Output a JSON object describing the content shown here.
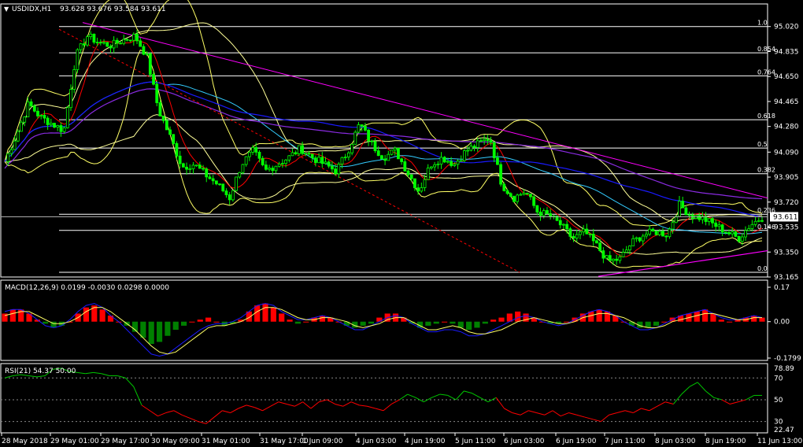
{
  "window": {
    "symbol_header": "USDIDX,H1",
    "ohlc": "93.628 93.676 93.584 93.611"
  },
  "colors": {
    "background": "#000000",
    "axis": "#ffffff",
    "candle": "#00ff00",
    "fib": "#ffffff",
    "bb_outer": "#ffff66",
    "bb_inner": "#ffff99",
    "ma_red": "#ff0000",
    "ma_cyan": "#33ccff",
    "ma_blue": "#1a1aff",
    "ma_purple": "#8a2be2",
    "trend_magenta": "#ff00ff",
    "trend_red_dash": "#ff0000",
    "macd_pos": "#ff0000",
    "macd_neg": "#008000",
    "macd_signal": "#ffff66",
    "macd_line": "#1a1aff",
    "rsi_above": "#00c800",
    "rsi_below": "#ff0000"
  },
  "chart_data": [
    {
      "type": "line",
      "name": "USDIDX,H1",
      "ylim": [
        93.165,
        95.1
      ],
      "y_ticks": [
        "95.020",
        "94.835",
        "94.650",
        "94.465",
        "94.280",
        "94.090",
        "93.905",
        "93.720",
        "93.535",
        "93.350",
        "93.165"
      ],
      "current_price": "93.611",
      "fib_levels": [
        {
          "label": "1.0",
          "value": 95.02
        },
        {
          "label": "0.854",
          "value": 94.825
        },
        {
          "label": "0.764",
          "value": 94.655
        },
        {
          "label": "0.618",
          "value": 94.33
        },
        {
          "label": "0.5",
          "value": 94.12
        },
        {
          "label": "0.382",
          "value": 93.93
        },
        {
          "label": "0.236",
          "value": 93.63
        },
        {
          "label": "0.146",
          "value": 93.51
        },
        {
          "label": "0.0",
          "value": 93.2
        }
      ],
      "x_labels": [
        "28 May 2018",
        "29 May 01:00",
        "29 May 17:00",
        "30 May 09:00",
        "31 May 01:00",
        "31 May 17:00",
        "1 Jun 09:00",
        "4 Jun 03:00",
        "4 Jun 19:00",
        "5 Jun 11:00",
        "6 Jun 03:00",
        "6 Jun 19:00",
        "7 Jun 11:00",
        "8 Jun 03:00",
        "8 Jun 19:00",
        "11 Jun 13:00"
      ],
      "price_path": [
        94.02,
        94.22,
        94.45,
        94.35,
        94.3,
        94.25,
        94.8,
        94.95,
        94.9,
        94.88,
        94.92,
        94.95,
        94.8,
        94.4,
        94.2,
        93.98,
        94.0,
        93.92,
        93.85,
        93.75,
        94.0,
        94.1,
        93.95,
        94.0,
        94.05,
        94.12,
        94.05,
        94.0,
        93.95,
        94.1,
        94.3,
        94.15,
        94.05,
        94.1,
        93.95,
        93.8,
        94.0,
        94.05,
        94.0,
        94.1,
        94.15,
        94.2,
        93.85,
        93.75,
        93.8,
        93.65,
        93.62,
        93.55,
        93.45,
        93.5,
        93.4,
        93.28,
        93.3,
        93.42,
        93.48,
        93.5,
        93.48,
        93.7,
        93.62,
        93.6,
        93.55,
        93.5,
        93.45,
        93.55,
        93.61
      ]
    },
    {
      "type": "bar",
      "name": "MACD(12,26,9)",
      "header": "MACD(12,26,9) 0.0199 -0.0030 0.0298 0.0000",
      "ylim": [
        -0.1799,
        0.17
      ],
      "y_ticks": [
        "0.17",
        "0.00",
        "-0.1799"
      ],
      "values": [
        0.04,
        0.06,
        0.06,
        0.04,
        0.01,
        -0.01,
        -0.03,
        -0.02,
        0.0,
        0.04,
        0.07,
        0.08,
        0.06,
        0.03,
        0.0,
        -0.02,
        -0.05,
        -0.08,
        -0.11,
        -0.1,
        -0.07,
        -0.04,
        -0.02,
        0.0,
        0.01,
        0.02,
        0.0,
        -0.02,
        -0.01,
        0.01,
        0.05,
        0.08,
        0.09,
        0.07,
        0.04,
        0.01,
        -0.01,
        0.0,
        0.02,
        0.03,
        0.02,
        0.0,
        -0.02,
        -0.03,
        -0.02,
        -0.01,
        0.02,
        0.04,
        0.04,
        0.02,
        -0.01,
        -0.03,
        -0.02,
        -0.01,
        0.0,
        -0.01,
        -0.03,
        -0.04,
        -0.03,
        -0.01,
        0.01,
        0.02,
        0.04,
        0.05,
        0.04,
        0.02,
        0.0,
        -0.01,
        -0.01,
        0.0,
        0.02,
        0.04,
        0.05,
        0.06,
        0.05,
        0.03,
        0.0,
        -0.02,
        -0.03,
        -0.03,
        -0.02,
        0.0,
        0.02,
        0.03,
        0.04,
        0.05,
        0.06,
        0.04,
        0.01,
        0.0,
        0.01,
        0.02,
        0.03,
        0.02
      ],
      "signal": [
        0.03,
        0.04,
        0.05,
        0.05,
        0.03,
        0.01,
        -0.01,
        -0.01,
        0.0,
        0.02,
        0.05,
        0.07,
        0.07,
        0.05,
        0.02,
        -0.01,
        -0.04,
        -0.08,
        -0.12,
        -0.15,
        -0.16,
        -0.15,
        -0.12,
        -0.09,
        -0.06,
        -0.03,
        -0.02,
        -0.02,
        -0.01,
        0.0,
        0.02,
        0.05,
        0.07,
        0.07,
        0.06,
        0.04,
        0.02,
        0.01,
        0.01,
        0.02,
        0.02,
        0.01,
        0.0,
        -0.02,
        -0.03,
        -0.02,
        -0.01,
        0.01,
        0.02,
        0.02,
        0.0,
        -0.02,
        -0.04,
        -0.04,
        -0.03,
        -0.02,
        -0.03,
        -0.05,
        -0.06,
        -0.06,
        -0.05,
        -0.04,
        -0.02,
        0.0,
        0.01,
        0.02,
        0.01,
        0.0,
        -0.01,
        -0.01,
        0.0,
        0.02,
        0.03,
        0.04,
        0.04,
        0.03,
        0.02,
        0.0,
        -0.02,
        -0.03,
        -0.03,
        -0.02,
        0.0,
        0.01,
        0.02,
        0.03,
        0.04,
        0.04,
        0.03,
        0.02,
        0.01,
        0.01,
        0.02,
        0.02
      ],
      "macd_line": [
        0.05,
        0.06,
        0.06,
        0.04,
        0.01,
        -0.02,
        -0.03,
        -0.02,
        0.01,
        0.05,
        0.08,
        0.09,
        0.07,
        0.03,
        0.0,
        -0.04,
        -0.08,
        -0.12,
        -0.16,
        -0.17,
        -0.16,
        -0.13,
        -0.1,
        -0.07,
        -0.04,
        -0.02,
        -0.01,
        -0.01,
        0.0,
        0.02,
        0.05,
        0.08,
        0.09,
        0.08,
        0.05,
        0.03,
        0.01,
        0.01,
        0.02,
        0.03,
        0.02,
        0.0,
        -0.02,
        -0.04,
        -0.04,
        -0.02,
        0.0,
        0.02,
        0.03,
        0.02,
        -0.01,
        -0.03,
        -0.05,
        -0.05,
        -0.04,
        -0.04,
        -0.05,
        -0.07,
        -0.07,
        -0.06,
        -0.04,
        -0.02,
        0.0,
        0.02,
        0.03,
        0.02,
        0.0,
        -0.01,
        -0.02,
        -0.01,
        0.01,
        0.03,
        0.05,
        0.06,
        0.05,
        0.03,
        0.0,
        -0.02,
        -0.04,
        -0.04,
        -0.03,
        -0.01,
        0.01,
        0.03,
        0.04,
        0.05,
        0.06,
        0.04,
        0.02,
        0.01,
        0.01,
        0.02,
        0.03,
        0.02
      ]
    },
    {
      "type": "line",
      "name": "RSI(21)",
      "header": "RSI(21) 54.37 50.00",
      "ylim": [
        22.47,
        78.89
      ],
      "y_ticks": [
        "78.89",
        "70",
        "50",
        "30",
        "22.47"
      ],
      "values": [
        70,
        72,
        73,
        72,
        71,
        72,
        78,
        79,
        76,
        75,
        74,
        75,
        74,
        72,
        72,
        70,
        62,
        45,
        40,
        35,
        38,
        40,
        36,
        33,
        30,
        28,
        34,
        40,
        38,
        42,
        45,
        43,
        40,
        44,
        48,
        46,
        44,
        48,
        42,
        48,
        50,
        46,
        44,
        48,
        45,
        44,
        42,
        40,
        46,
        50,
        55,
        52,
        48,
        52,
        55,
        54,
        50,
        58,
        56,
        52,
        48,
        52,
        42,
        38,
        36,
        40,
        38,
        36,
        40,
        35,
        38,
        36,
        34,
        32,
        30,
        36,
        38,
        40,
        38,
        42,
        40,
        44,
        48,
        46,
        55,
        62,
        66,
        58,
        52,
        50,
        46,
        48,
        50,
        54,
        54
      ]
    }
  ]
}
